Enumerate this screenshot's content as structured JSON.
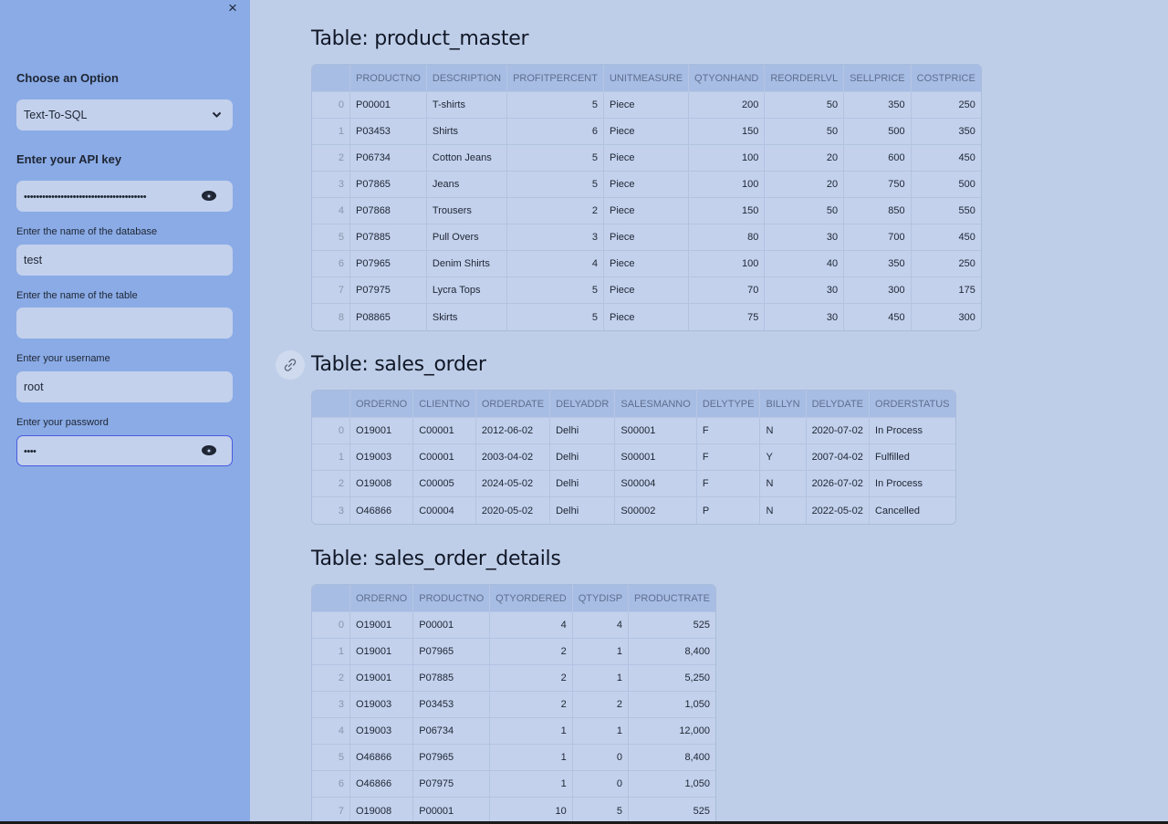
{
  "sidebar": {
    "close_label": "×",
    "option_label": "Choose an Option",
    "option_value": "Text-To-SQL",
    "api_key_label": "Enter your API key",
    "api_key_value": "••••••••••••••••••••••••••••••••••••••••",
    "database_label": "Enter the name of the database",
    "database_value": "test",
    "table_label": "Enter the name of the table",
    "table_value": "",
    "username_label": "Enter your username",
    "username_value": "root",
    "password_label": "Enter your password",
    "password_value": "••••"
  },
  "tables": [
    {
      "title": "Table: product_master",
      "columns": [
        "",
        "PRODUCTNO",
        "DESCRIPTION",
        "PROFITPERCENT",
        "UNITMEASURE",
        "QTYONHAND",
        "REORDERLVL",
        "SELLPRICE",
        "COSTPRICE"
      ],
      "numeric": [
        false,
        false,
        false,
        true,
        false,
        true,
        true,
        true,
        true
      ],
      "rows": [
        [
          "0",
          "P00001",
          "T-shirts",
          "5",
          "Piece",
          "200",
          "50",
          "350",
          "250"
        ],
        [
          "1",
          "P03453",
          "Shirts",
          "6",
          "Piece",
          "150",
          "50",
          "500",
          "350"
        ],
        [
          "2",
          "P06734",
          "Cotton Jeans",
          "5",
          "Piece",
          "100",
          "20",
          "600",
          "450"
        ],
        [
          "3",
          "P07865",
          "Jeans",
          "5",
          "Piece",
          "100",
          "20",
          "750",
          "500"
        ],
        [
          "4",
          "P07868",
          "Trousers",
          "2",
          "Piece",
          "150",
          "50",
          "850",
          "550"
        ],
        [
          "5",
          "P07885",
          "Pull Overs",
          "3",
          "Piece",
          "80",
          "30",
          "700",
          "450"
        ],
        [
          "6",
          "P07965",
          "Denim Shirts",
          "4",
          "Piece",
          "100",
          "40",
          "350",
          "250"
        ],
        [
          "7",
          "P07975",
          "Lycra Tops",
          "5",
          "Piece",
          "70",
          "30",
          "300",
          "175"
        ],
        [
          "8",
          "P08865",
          "Skirts",
          "5",
          "Piece",
          "75",
          "30",
          "450",
          "300"
        ]
      ]
    },
    {
      "title": "Table: sales_order",
      "columns": [
        "",
        "ORDERNO",
        "CLIENTNO",
        "ORDERDATE",
        "DELYADDR",
        "SALESMANNO",
        "DELYTYPE",
        "BILLYN",
        "DELYDATE",
        "ORDERSTATUS"
      ],
      "numeric": [
        false,
        false,
        false,
        false,
        false,
        false,
        false,
        false,
        false,
        false
      ],
      "rows": [
        [
          "0",
          "O19001",
          "C00001",
          "2012-06-02",
          "Delhi",
          "S00001",
          "F",
          "N",
          "2020-07-02",
          "In Process"
        ],
        [
          "1",
          "O19003",
          "C00001",
          "2003-04-02",
          "Delhi",
          "S00001",
          "F",
          "Y",
          "2007-04-02",
          "Fulfilled"
        ],
        [
          "2",
          "O19008",
          "C00005",
          "2024-05-02",
          "Delhi",
          "S00004",
          "F",
          "N",
          "2026-07-02",
          "In Process"
        ],
        [
          "3",
          "O46866",
          "C00004",
          "2020-05-02",
          "Delhi",
          "S00002",
          "P",
          "N",
          "2022-05-02",
          "Cancelled"
        ]
      ]
    },
    {
      "title": "Table: sales_order_details",
      "columns": [
        "",
        "ORDERNO",
        "PRODUCTNO",
        "QTYORDERED",
        "QTYDISP",
        "PRODUCTRATE"
      ],
      "numeric": [
        false,
        false,
        false,
        true,
        true,
        true
      ],
      "rows": [
        [
          "0",
          "O19001",
          "P00001",
          "4",
          "4",
          "525"
        ],
        [
          "1",
          "O19001",
          "P07965",
          "2",
          "1",
          "8,400"
        ],
        [
          "2",
          "O19001",
          "P07885",
          "2",
          "1",
          "5,250"
        ],
        [
          "3",
          "O19003",
          "P03453",
          "2",
          "2",
          "1,050"
        ],
        [
          "4",
          "O19003",
          "P06734",
          "1",
          "1",
          "12,000"
        ],
        [
          "5",
          "O46866",
          "P07965",
          "1",
          "0",
          "8,400"
        ],
        [
          "6",
          "O46866",
          "P07975",
          "1",
          "0",
          "1,050"
        ],
        [
          "7",
          "O19008",
          "P00001",
          "10",
          "5",
          "525"
        ]
      ]
    }
  ]
}
